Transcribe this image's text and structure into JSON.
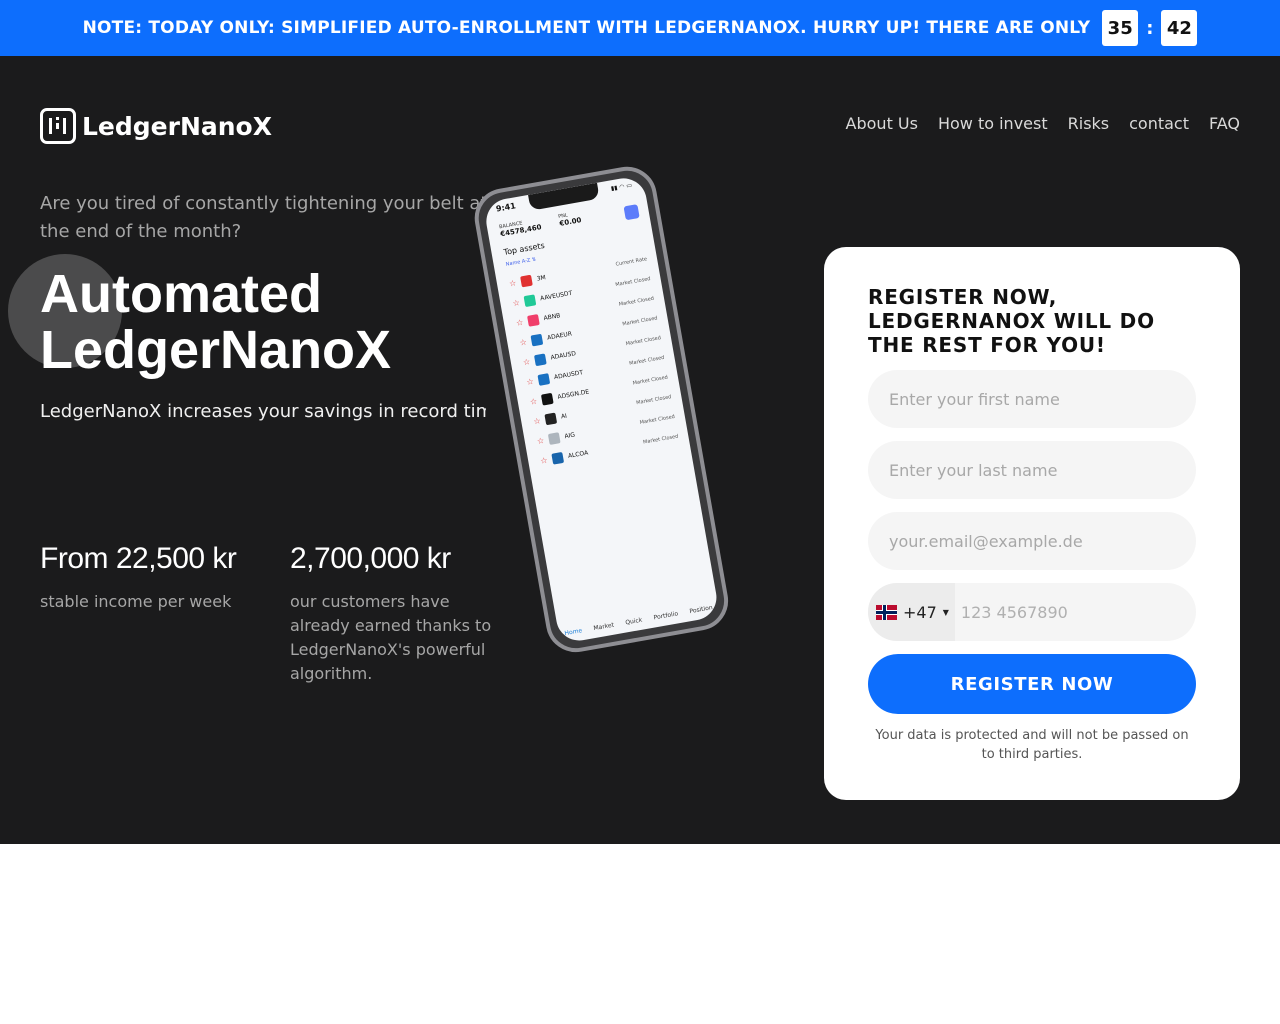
{
  "banner": {
    "note": "NOTE: TODAY ONLY: SIMPLIFIED AUTO-ENROLLMENT WITH LEDGERNANOX. HURRY UP! THERE ARE ONLY",
    "minutes": "35",
    "separator": ":",
    "seconds": "42",
    "color": "#0d6efd"
  },
  "header": {
    "logo_text": "LedgerNanoX",
    "nav": [
      "About Us",
      "How to invest",
      "Risks",
      "contact",
      "FAQ"
    ]
  },
  "hero": {
    "tagline": "Are you tired of constantly tightening your belt at the end of the month?",
    "headline_line1": "Automated",
    "headline_line2": "LedgerNanoX",
    "subtitle": "LedgerNanoX increases your savings in record time",
    "stats": [
      {
        "value": "From 22,500 kr",
        "description": "stable income per week"
      },
      {
        "value": "2,700,000 kr",
        "description": "our customers have already earned thanks to LedgerNanoX's powerful algorithm."
      }
    ],
    "background_color": "#1b1b1c"
  },
  "phone_app": {
    "time": "9:41",
    "balance_label": "BALANCE",
    "balance_value": "€4578,460",
    "pnl_label": "PNL",
    "pnl_value": "€0.00",
    "section_title": "Top assets",
    "sort_label": "Name A-Z ⇅",
    "assets": [
      {
        "name": "3M",
        "status": "Current Rate",
        "color": "#e03131"
      },
      {
        "name": "AAVEUSDT",
        "status": "Market Closed",
        "color": "#20c997"
      },
      {
        "name": "ABNB",
        "status": "Market Closed",
        "color": "#f03e6a"
      },
      {
        "name": "ADAEUR",
        "status": "Market Closed",
        "color": "#1971c2"
      },
      {
        "name": "ADAUSD",
        "status": "Market Closed",
        "color": "#1971c2"
      },
      {
        "name": "ADAUSDT",
        "status": "Market Closed",
        "color": "#1971c2"
      },
      {
        "name": "ADSGN.DE",
        "status": "Market Closed",
        "color": "#111111"
      },
      {
        "name": "AI",
        "status": "Market Closed",
        "color": "#222222"
      },
      {
        "name": "AIG",
        "status": "Market Closed",
        "color": "#adb5bd"
      },
      {
        "name": "ALCOA",
        "status": "Market Closed",
        "color": "#1864ab"
      }
    ],
    "tabs": [
      "Home",
      "Market",
      "Quick",
      "Portfolio",
      "Position"
    ]
  },
  "form": {
    "title": "REGISTER NOW, LEDGERNANOX WILL DO THE REST FOR YOU!",
    "first_name_placeholder": "Enter your first name",
    "last_name_placeholder": "Enter your last name",
    "email_placeholder": "your.email@example.de",
    "country_code": "+47",
    "phone_placeholder": "123 4567890",
    "submit_label": "REGISTER NOW",
    "privacy_text": "Your data is protected and will not be passed on to third parties."
  }
}
